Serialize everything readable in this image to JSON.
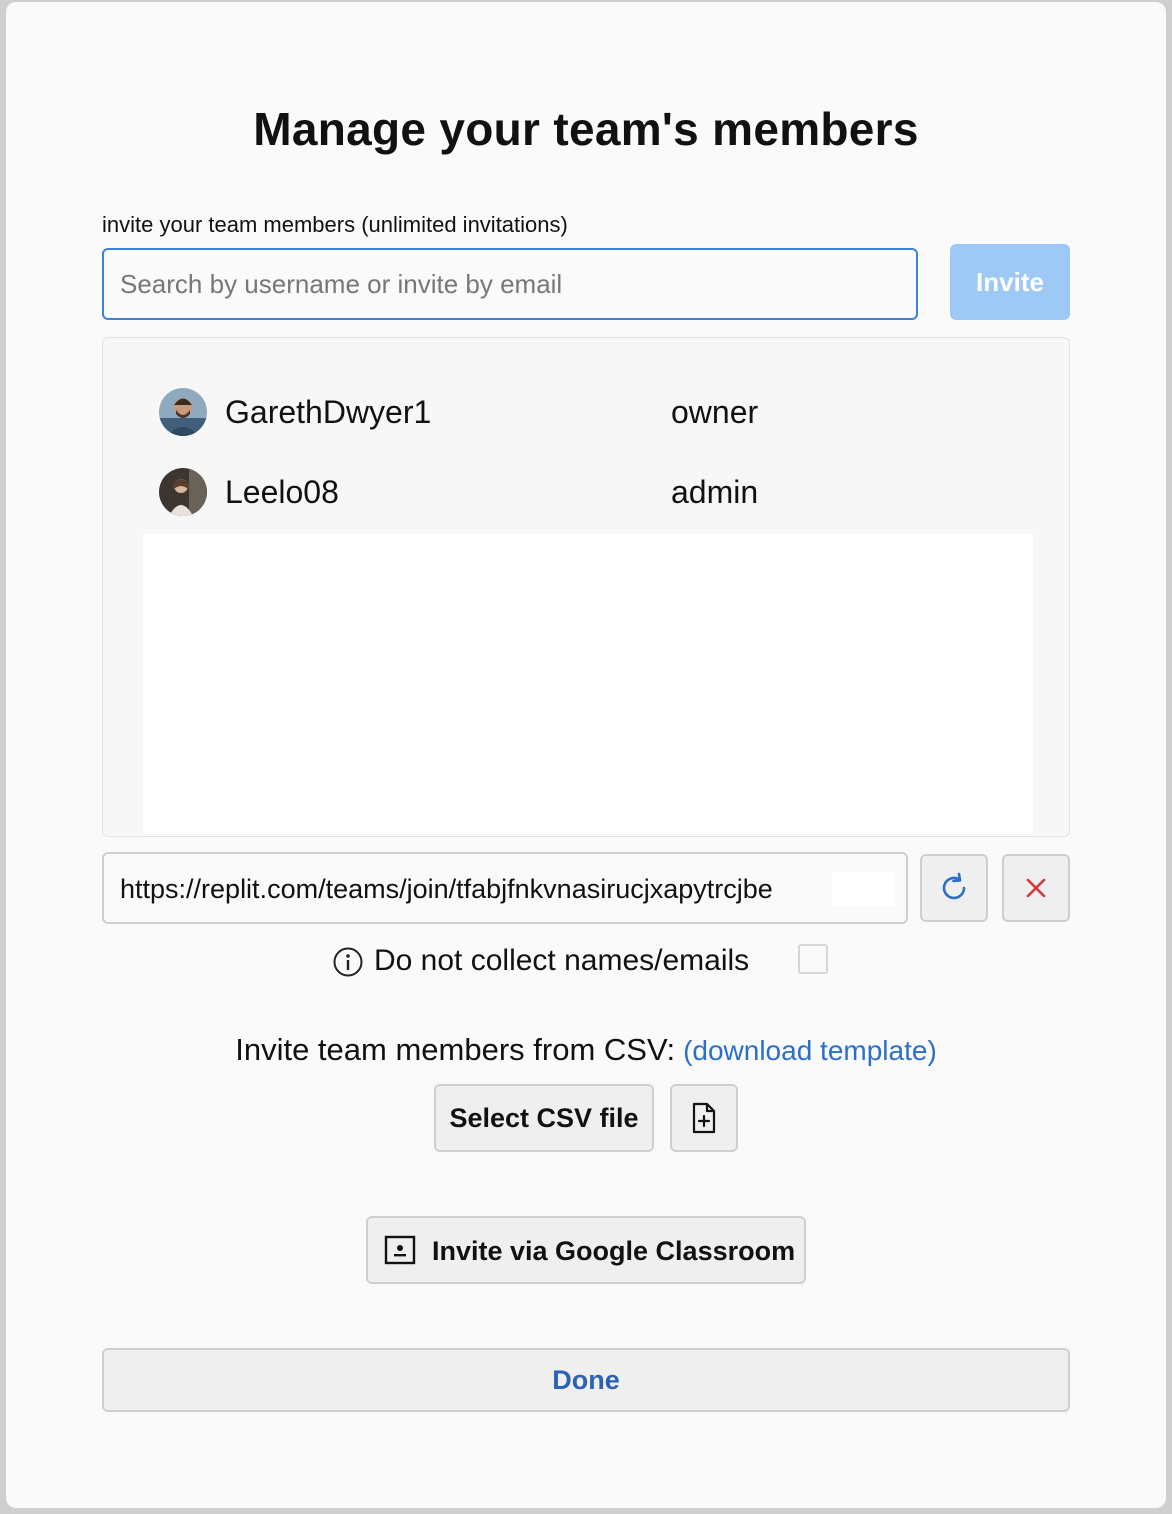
{
  "modal": {
    "title": "Manage your team's members",
    "invite_label": "invite your team members (unlimited invitations)"
  },
  "search": {
    "placeholder": "Search by username or invite by email",
    "value": ""
  },
  "invite_button": {
    "label": "Invite"
  },
  "members": [
    {
      "username": "GarethDwyer1",
      "role": "owner",
      "avatar_icon": "avatar-photo-gareth"
    },
    {
      "username": "Leelo08",
      "role": "admin",
      "avatar_icon": "avatar-photo-leelo"
    }
  ],
  "join_link": {
    "url": "https://replit.com/teams/join/tfabjfnkvnasirucjxapytrcjbe",
    "refresh_icon": "refresh-icon",
    "delete_icon": "close-icon"
  },
  "privacy": {
    "info_icon": "info-icon",
    "label": "Do not collect names/emails",
    "checked": false
  },
  "csv": {
    "label": "Invite team members from CSV:",
    "template_link": "(download template)",
    "select_button": "Select CSV file",
    "add_file_icon": "file-plus-icon"
  },
  "classroom": {
    "label": "Invite via Google Classroom",
    "icon": "google-classroom-icon"
  },
  "done_button": {
    "label": "Done"
  },
  "colors": {
    "accent_blue": "#3c82d6",
    "invite_button_disabled": "#9ec8f5",
    "link_blue": "#2a6fc9",
    "delete_red": "#d33a3a"
  }
}
